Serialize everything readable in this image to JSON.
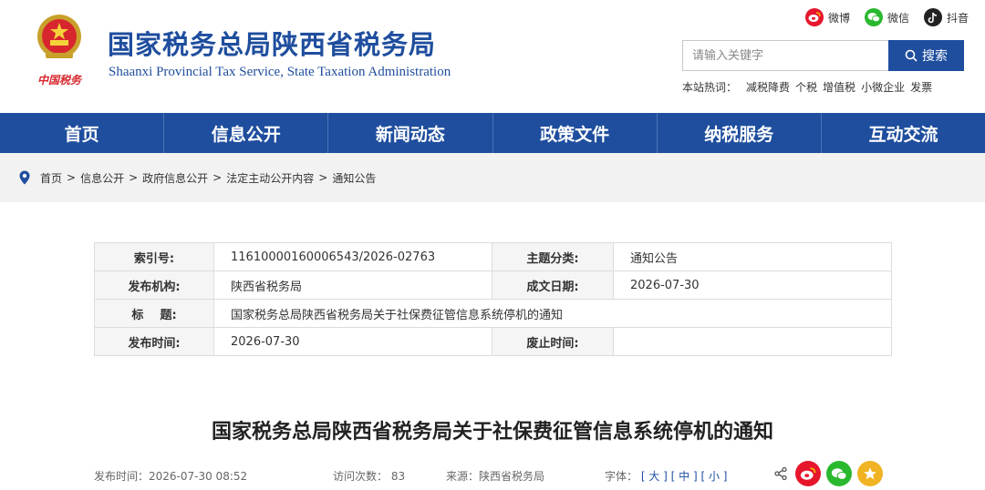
{
  "header": {
    "title": "国家税务总局陕西省税务局",
    "subtitle": "Shaanxi Provincial Tax Service, State Taxation Administration",
    "emblem_text": "中国税务",
    "social": [
      {
        "label": "微博",
        "icon": "weibo-icon"
      },
      {
        "label": "微信",
        "icon": "wechat-icon"
      },
      {
        "label": "抖音",
        "icon": "douyin-icon"
      }
    ],
    "search": {
      "placeholder": "请输入关键字",
      "button_label": "搜索"
    },
    "hot_words": {
      "label": "本站热词：",
      "items": [
        "减税降费",
        "个税",
        "增值税",
        "小微企业",
        "发票"
      ]
    }
  },
  "nav": [
    "首页",
    "信息公开",
    "新闻动态",
    "政策文件",
    "纳税服务",
    "互动交流"
  ],
  "breadcrumb": [
    "首页",
    "信息公开",
    "政府信息公开",
    "法定主动公开内容",
    "通知公告"
  ],
  "breadcrumb_sep": ">",
  "meta": {
    "index_label": "索引号:",
    "index_value": "11610000160006543/2026-02763",
    "topic_label": "主题分类:",
    "topic_value": "通知公告",
    "issuer_label": "发布机构:",
    "issuer_value": "陕西省税务局",
    "date_label": "成文日期:",
    "date_value": "2026-07-30",
    "title_label": "标    题:",
    "title_value": "国家税务总局陕西省税务局关于社保费征管信息系统停机的通知",
    "publish_label": "发布时间:",
    "publish_value": "2026-07-30",
    "expire_label": "废止时间:",
    "expire_value": ""
  },
  "article": {
    "title": "国家税务总局陕西省税务局关于社保费征管信息系统停机的通知",
    "publish_time": "发布时间：2026-07-30 08:52",
    "visits": "访问次数：  83",
    "source": "来源：陕西省税务局",
    "font_label": "字体：",
    "font_large": "[ 大 ]",
    "font_medium": "[ 中 ]",
    "font_small": "[ 小 ]"
  },
  "colors": {
    "brand_blue": "#1f4e9e",
    "weibo_red": "#e6162d",
    "wechat_green": "#2ab82f",
    "star_yellow": "#f0b323"
  }
}
